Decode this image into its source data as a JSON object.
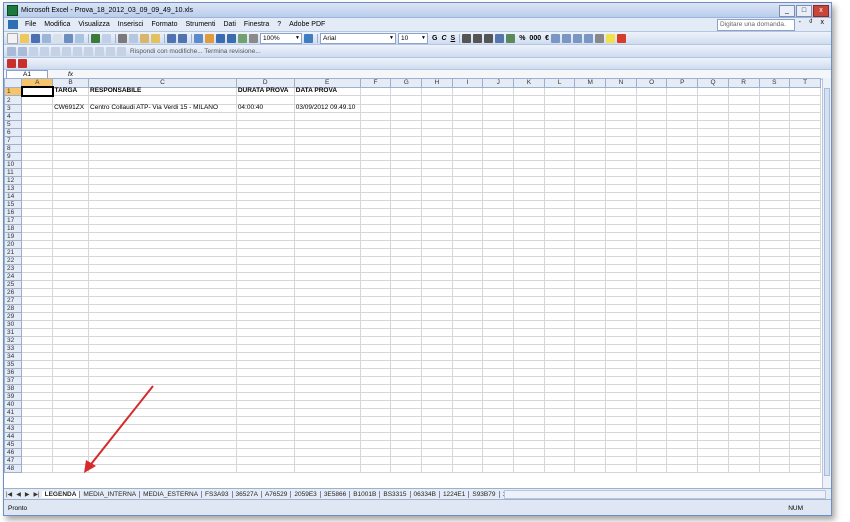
{
  "window": {
    "title": "Microsoft Excel - Prova_18_2012_03_09_09_49_10.xls",
    "min": "_",
    "max": "□",
    "close": "x"
  },
  "menu": {
    "items": [
      "File",
      "Modifica",
      "Visualizza",
      "Inserisci",
      "Formato",
      "Strumenti",
      "Dati",
      "Finestra",
      "?",
      "Adobe PDF"
    ],
    "help_placeholder": "Digitare una domanda.",
    "doc_buttons": "- ₫ x"
  },
  "toolbar": {
    "zoom": "100%",
    "font": "Arial",
    "font_size": "10",
    "bold": "G",
    "italic": "C",
    "underline": "S",
    "percent": "%",
    "thousands": "000",
    "euro": "€"
  },
  "review_bar": {
    "text": "Rispondi con modifiche...  Termina revisione..."
  },
  "formula": {
    "namebox": "A1",
    "fx": "fx"
  },
  "grid": {
    "columns": [
      "A",
      "B",
      "C",
      "D",
      "E",
      "F",
      "G",
      "H",
      "I",
      "J",
      "K",
      "L",
      "M",
      "N",
      "O",
      "P",
      "Q",
      "R",
      "S",
      "T"
    ],
    "header_row": [
      "",
      "TARGA",
      "RESPONSABILE",
      "DURATA PROVA",
      "DATA PROVA"
    ],
    "data_row": [
      "",
      "CW691ZX",
      "Centro Collaudi  ATP- Via  Verdi  15  -  MILANO",
      "04:00:40",
      "03/09/2012 09.49.10"
    ],
    "row_count": 48
  },
  "sheets": [
    "LEGENDA",
    "MEDIA_INTERNA",
    "MEDIA_ESTERNA",
    "FS3A93",
    "36527A",
    "A76529",
    "2059E3",
    "3E5866",
    "B1001B",
    "BS3315",
    "06334B",
    "1224E1",
    "S93B79",
    "125("
  ],
  "status": {
    "left": "Pronto",
    "right": "NUM"
  },
  "annotation": {
    "color": "#d42b2b"
  }
}
